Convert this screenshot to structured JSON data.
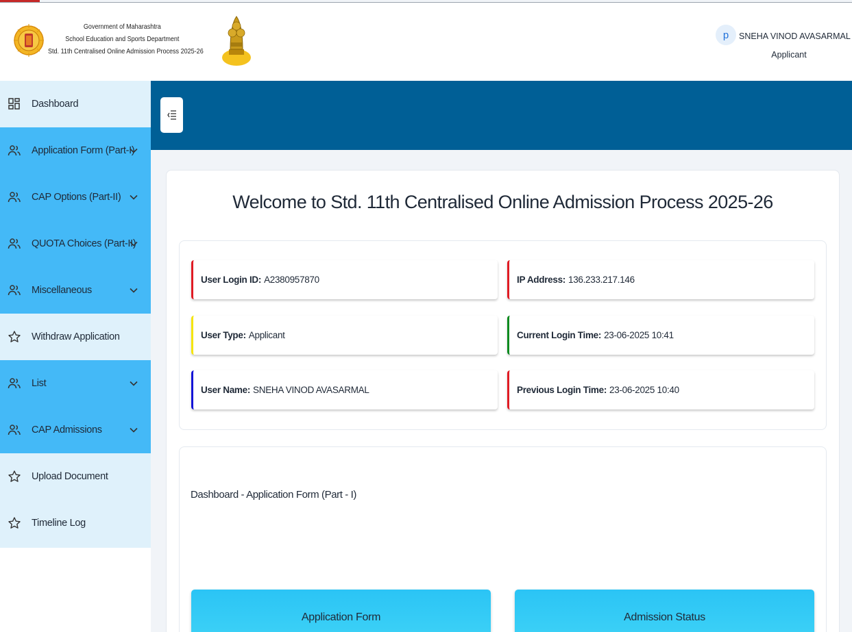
{
  "header": {
    "line1": "Government of Maharashtra",
    "line2": "School Education and Sports Department",
    "line3": "Std. 11th Centralised Online Admission Process 2025-26"
  },
  "user": {
    "avatar_letter": "p",
    "name": "SNEHA VINOD AVASARMAL",
    "role": "Applicant"
  },
  "sidebar": {
    "items": [
      {
        "label": "Dashboard",
        "icon": "dashboard-grid-icon",
        "expandable": false
      },
      {
        "label": "Application Form (Part-I)",
        "icon": "users-icon",
        "expandable": true
      },
      {
        "label": "CAP Options (Part-II)",
        "icon": "users-icon",
        "expandable": true
      },
      {
        "label": "QUOTA Choices (Part-II)",
        "icon": "users-icon",
        "expandable": true
      },
      {
        "label": "Miscellaneous",
        "icon": "users-icon",
        "expandable": true
      },
      {
        "label": "Withdraw Application",
        "icon": "star-icon",
        "expandable": false
      },
      {
        "label": "List",
        "icon": "users-icon",
        "expandable": true
      },
      {
        "label": "CAP Admissions",
        "icon": "users-icon",
        "expandable": true
      },
      {
        "label": "Upload Document",
        "icon": "star-icon",
        "expandable": false
      },
      {
        "label": "Timeline Log",
        "icon": "star-icon",
        "expandable": false
      }
    ]
  },
  "main": {
    "welcome": "Welcome to Std. 11th Centralised Online Admission Process 2025-26",
    "info": [
      {
        "key": "User Login ID:",
        "value": "A2380957870",
        "accent": "#e01b24"
      },
      {
        "key": "IP Address:",
        "value": "136.233.217.146",
        "accent": "#e01b24"
      },
      {
        "key": "User Type:",
        "value": "Applicant",
        "accent": "#f5e50a"
      },
      {
        "key": "Current Login Time:",
        "value": "23-06-2025 10:41",
        "accent": "#0a8a1f"
      },
      {
        "key": "User Name:",
        "value": "SNEHA VINOD AVASARMAL",
        "accent": "#1414d6"
      },
      {
        "key": "Previous Login Time:",
        "value": "23-06-2025 10:40",
        "accent": "#e01b24"
      }
    ],
    "dashboard_title": "Dashboard - Application Form (Part - I)",
    "cards": [
      {
        "label": "Application Form"
      },
      {
        "label": "Admission Status"
      }
    ]
  },
  "colors": {
    "banner": "#005f96",
    "sidebar_active": "#44b9f7",
    "sidebar_light": "#dff1fb"
  }
}
